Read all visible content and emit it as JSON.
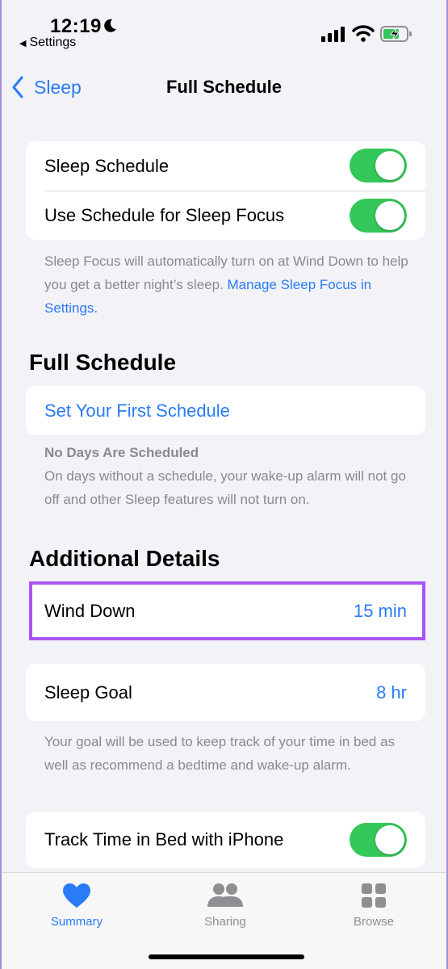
{
  "status_bar": {
    "time": "12:19",
    "back_app": "Settings",
    "icons": [
      "moon-icon",
      "signal-icon",
      "wifi-icon",
      "battery-charging-icon"
    ]
  },
  "nav": {
    "back_label": "Sleep",
    "title": "Full Schedule"
  },
  "focus_card": {
    "sleep_schedule_label": "Sleep Schedule",
    "sleep_schedule_on": true,
    "use_schedule_label": "Use Schedule for Sleep Focus",
    "use_schedule_on": true
  },
  "focus_footnote": {
    "text": "Sleep Focus will automatically turn on at Wind Down to help you get a better night’s sleep.",
    "link": "Manage Sleep Focus in Settings."
  },
  "full_schedule": {
    "header": "Full Schedule",
    "set_first_label": "Set Your First Schedule",
    "no_days_title": "No Days Are Scheduled",
    "no_days_text": "On days without a schedule, your wake-up alarm will not go off and other Sleep features will not turn on."
  },
  "additional_details": {
    "header": "Additional Details",
    "wind_down_label": "Wind Down",
    "wind_down_value": "15 min",
    "sleep_goal_label": "Sleep Goal",
    "sleep_goal_value": "8 hr",
    "goal_footnote": "Your goal will be used to keep track of your time in bed as well as recommend a bedtime and wake-up alarm.",
    "track_label": "Track Time in Bed with iPhone",
    "track_on": true
  },
  "tabbar": {
    "tabs": [
      {
        "label": "Summary",
        "icon": "heart-icon",
        "active": true
      },
      {
        "label": "Sharing",
        "icon": "people-icon",
        "active": false
      },
      {
        "label": "Browse",
        "icon": "grid-icon",
        "active": false
      }
    ]
  },
  "colors": {
    "accent": "#2a7bf6",
    "toggle_on": "#34c759",
    "highlight": "#a855f7",
    "background": "#f2f2f7"
  }
}
